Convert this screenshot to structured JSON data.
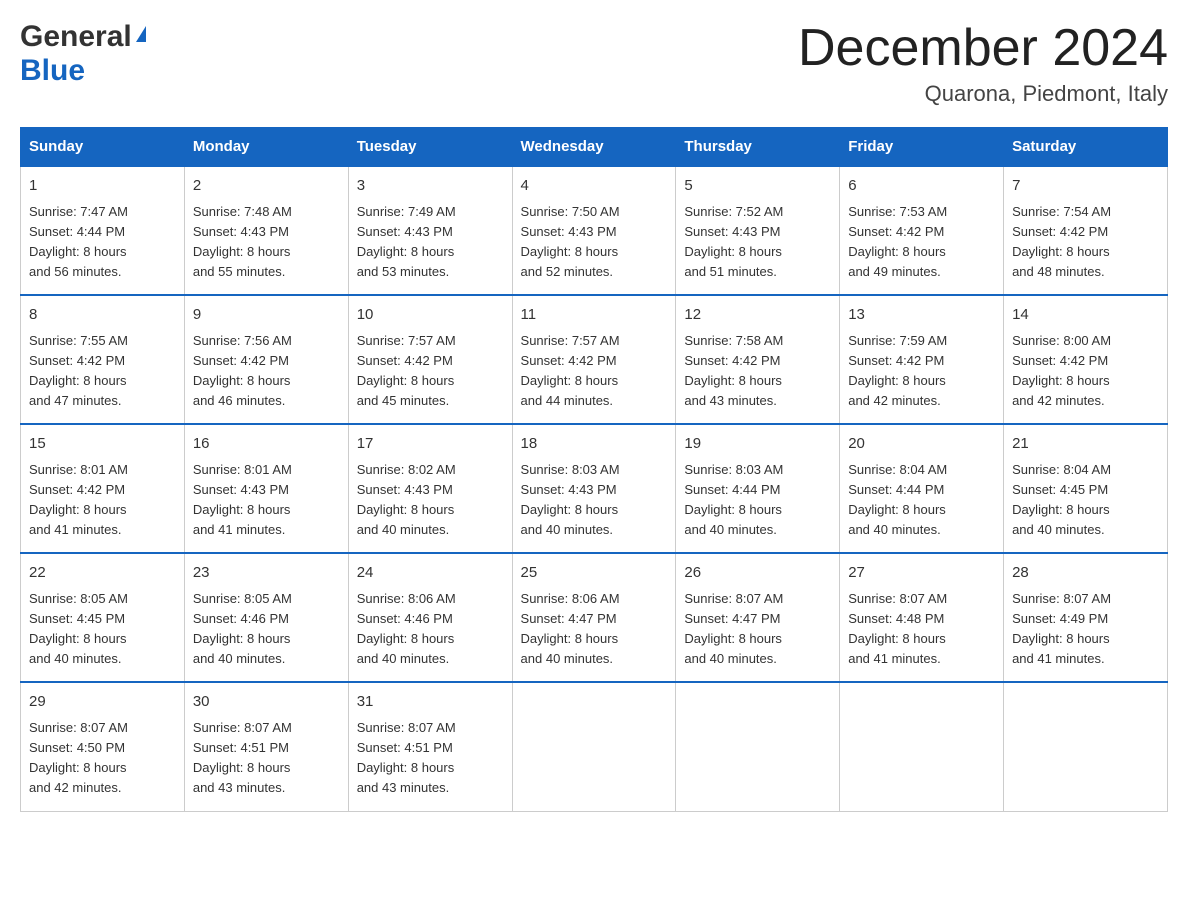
{
  "logo": {
    "line1": "General",
    "line2": "Blue"
  },
  "title": "December 2024",
  "subtitle": "Quarona, Piedmont, Italy",
  "days_of_week": [
    "Sunday",
    "Monday",
    "Tuesday",
    "Wednesday",
    "Thursday",
    "Friday",
    "Saturday"
  ],
  "weeks": [
    [
      {
        "day": "1",
        "sunrise": "7:47 AM",
        "sunset": "4:44 PM",
        "daylight": "8 hours and 56 minutes."
      },
      {
        "day": "2",
        "sunrise": "7:48 AM",
        "sunset": "4:43 PM",
        "daylight": "8 hours and 55 minutes."
      },
      {
        "day": "3",
        "sunrise": "7:49 AM",
        "sunset": "4:43 PM",
        "daylight": "8 hours and 53 minutes."
      },
      {
        "day": "4",
        "sunrise": "7:50 AM",
        "sunset": "4:43 PM",
        "daylight": "8 hours and 52 minutes."
      },
      {
        "day": "5",
        "sunrise": "7:52 AM",
        "sunset": "4:43 PM",
        "daylight": "8 hours and 51 minutes."
      },
      {
        "day": "6",
        "sunrise": "7:53 AM",
        "sunset": "4:42 PM",
        "daylight": "8 hours and 49 minutes."
      },
      {
        "day": "7",
        "sunrise": "7:54 AM",
        "sunset": "4:42 PM",
        "daylight": "8 hours and 48 minutes."
      }
    ],
    [
      {
        "day": "8",
        "sunrise": "7:55 AM",
        "sunset": "4:42 PM",
        "daylight": "8 hours and 47 minutes."
      },
      {
        "day": "9",
        "sunrise": "7:56 AM",
        "sunset": "4:42 PM",
        "daylight": "8 hours and 46 minutes."
      },
      {
        "day": "10",
        "sunrise": "7:57 AM",
        "sunset": "4:42 PM",
        "daylight": "8 hours and 45 minutes."
      },
      {
        "day": "11",
        "sunrise": "7:57 AM",
        "sunset": "4:42 PM",
        "daylight": "8 hours and 44 minutes."
      },
      {
        "day": "12",
        "sunrise": "7:58 AM",
        "sunset": "4:42 PM",
        "daylight": "8 hours and 43 minutes."
      },
      {
        "day": "13",
        "sunrise": "7:59 AM",
        "sunset": "4:42 PM",
        "daylight": "8 hours and 42 minutes."
      },
      {
        "day": "14",
        "sunrise": "8:00 AM",
        "sunset": "4:42 PM",
        "daylight": "8 hours and 42 minutes."
      }
    ],
    [
      {
        "day": "15",
        "sunrise": "8:01 AM",
        "sunset": "4:42 PM",
        "daylight": "8 hours and 41 minutes."
      },
      {
        "day": "16",
        "sunrise": "8:01 AM",
        "sunset": "4:43 PM",
        "daylight": "8 hours and 41 minutes."
      },
      {
        "day": "17",
        "sunrise": "8:02 AM",
        "sunset": "4:43 PM",
        "daylight": "8 hours and 40 minutes."
      },
      {
        "day": "18",
        "sunrise": "8:03 AM",
        "sunset": "4:43 PM",
        "daylight": "8 hours and 40 minutes."
      },
      {
        "day": "19",
        "sunrise": "8:03 AM",
        "sunset": "4:44 PM",
        "daylight": "8 hours and 40 minutes."
      },
      {
        "day": "20",
        "sunrise": "8:04 AM",
        "sunset": "4:44 PM",
        "daylight": "8 hours and 40 minutes."
      },
      {
        "day": "21",
        "sunrise": "8:04 AM",
        "sunset": "4:45 PM",
        "daylight": "8 hours and 40 minutes."
      }
    ],
    [
      {
        "day": "22",
        "sunrise": "8:05 AM",
        "sunset": "4:45 PM",
        "daylight": "8 hours and 40 minutes."
      },
      {
        "day": "23",
        "sunrise": "8:05 AM",
        "sunset": "4:46 PM",
        "daylight": "8 hours and 40 minutes."
      },
      {
        "day": "24",
        "sunrise": "8:06 AM",
        "sunset": "4:46 PM",
        "daylight": "8 hours and 40 minutes."
      },
      {
        "day": "25",
        "sunrise": "8:06 AM",
        "sunset": "4:47 PM",
        "daylight": "8 hours and 40 minutes."
      },
      {
        "day": "26",
        "sunrise": "8:07 AM",
        "sunset": "4:47 PM",
        "daylight": "8 hours and 40 minutes."
      },
      {
        "day": "27",
        "sunrise": "8:07 AM",
        "sunset": "4:48 PM",
        "daylight": "8 hours and 41 minutes."
      },
      {
        "day": "28",
        "sunrise": "8:07 AM",
        "sunset": "4:49 PM",
        "daylight": "8 hours and 41 minutes."
      }
    ],
    [
      {
        "day": "29",
        "sunrise": "8:07 AM",
        "sunset": "4:50 PM",
        "daylight": "8 hours and 42 minutes."
      },
      {
        "day": "30",
        "sunrise": "8:07 AM",
        "sunset": "4:51 PM",
        "daylight": "8 hours and 43 minutes."
      },
      {
        "day": "31",
        "sunrise": "8:07 AM",
        "sunset": "4:51 PM",
        "daylight": "8 hours and 43 minutes."
      },
      null,
      null,
      null,
      null
    ]
  ],
  "labels": {
    "sunrise": "Sunrise:",
    "sunset": "Sunset:",
    "daylight": "Daylight:"
  }
}
